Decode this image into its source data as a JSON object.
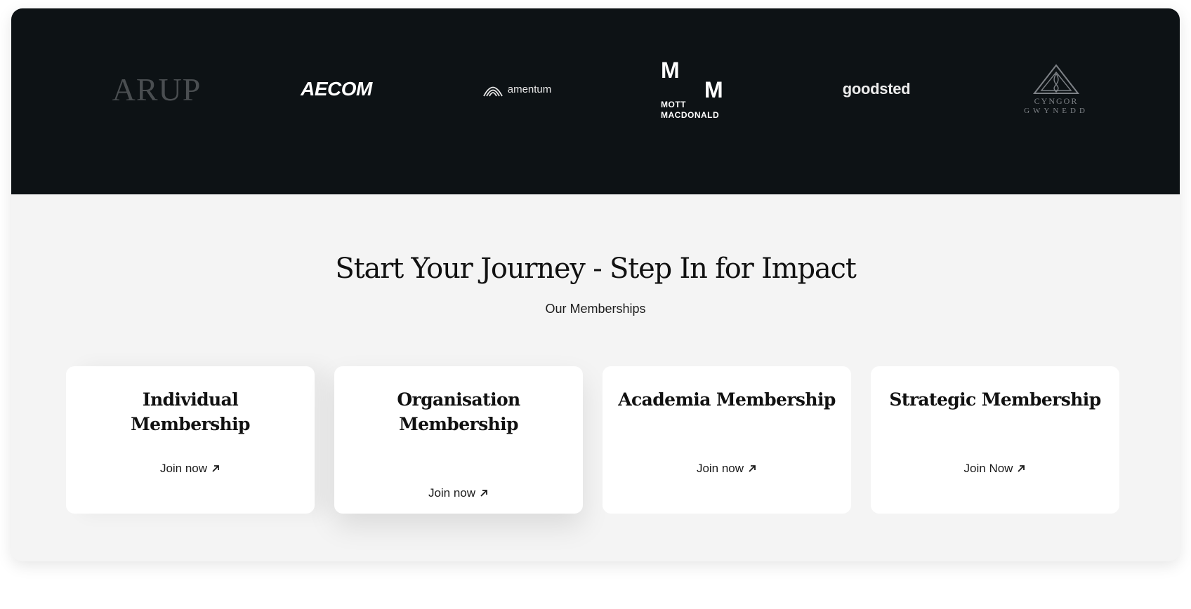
{
  "partners": {
    "logos": [
      {
        "name": "ARUP"
      },
      {
        "name": "AECOM"
      },
      {
        "name": "amentum"
      },
      {
        "name": "MOTT MACDONALD",
        "mark_top": "M",
        "mark_bottom": "M",
        "line1": "MOTT",
        "line2": "MACDONALD"
      },
      {
        "name": "goodsted"
      },
      {
        "name": "CYNGOR GWYNEDD",
        "line1": "CYNGOR",
        "line2": "GWYNEDD"
      }
    ]
  },
  "memberships": {
    "heading": "Start Your Journey - Step In for Impact",
    "subheading": "Our Memberships",
    "cards": [
      {
        "title": "Individual Membership",
        "link": "Join now"
      },
      {
        "title": "Organisation Membership",
        "link": "Join now"
      },
      {
        "title": "Academia Membership",
        "link": "Join now"
      },
      {
        "title": "Strategic Membership",
        "link": "Join Now"
      }
    ],
    "link_icon": "arrow-up-right-icon"
  },
  "colors": {
    "band_background": "#0d1215",
    "section_background": "#f4f4f4",
    "card_background": "#ffffff",
    "text": "#111111"
  }
}
